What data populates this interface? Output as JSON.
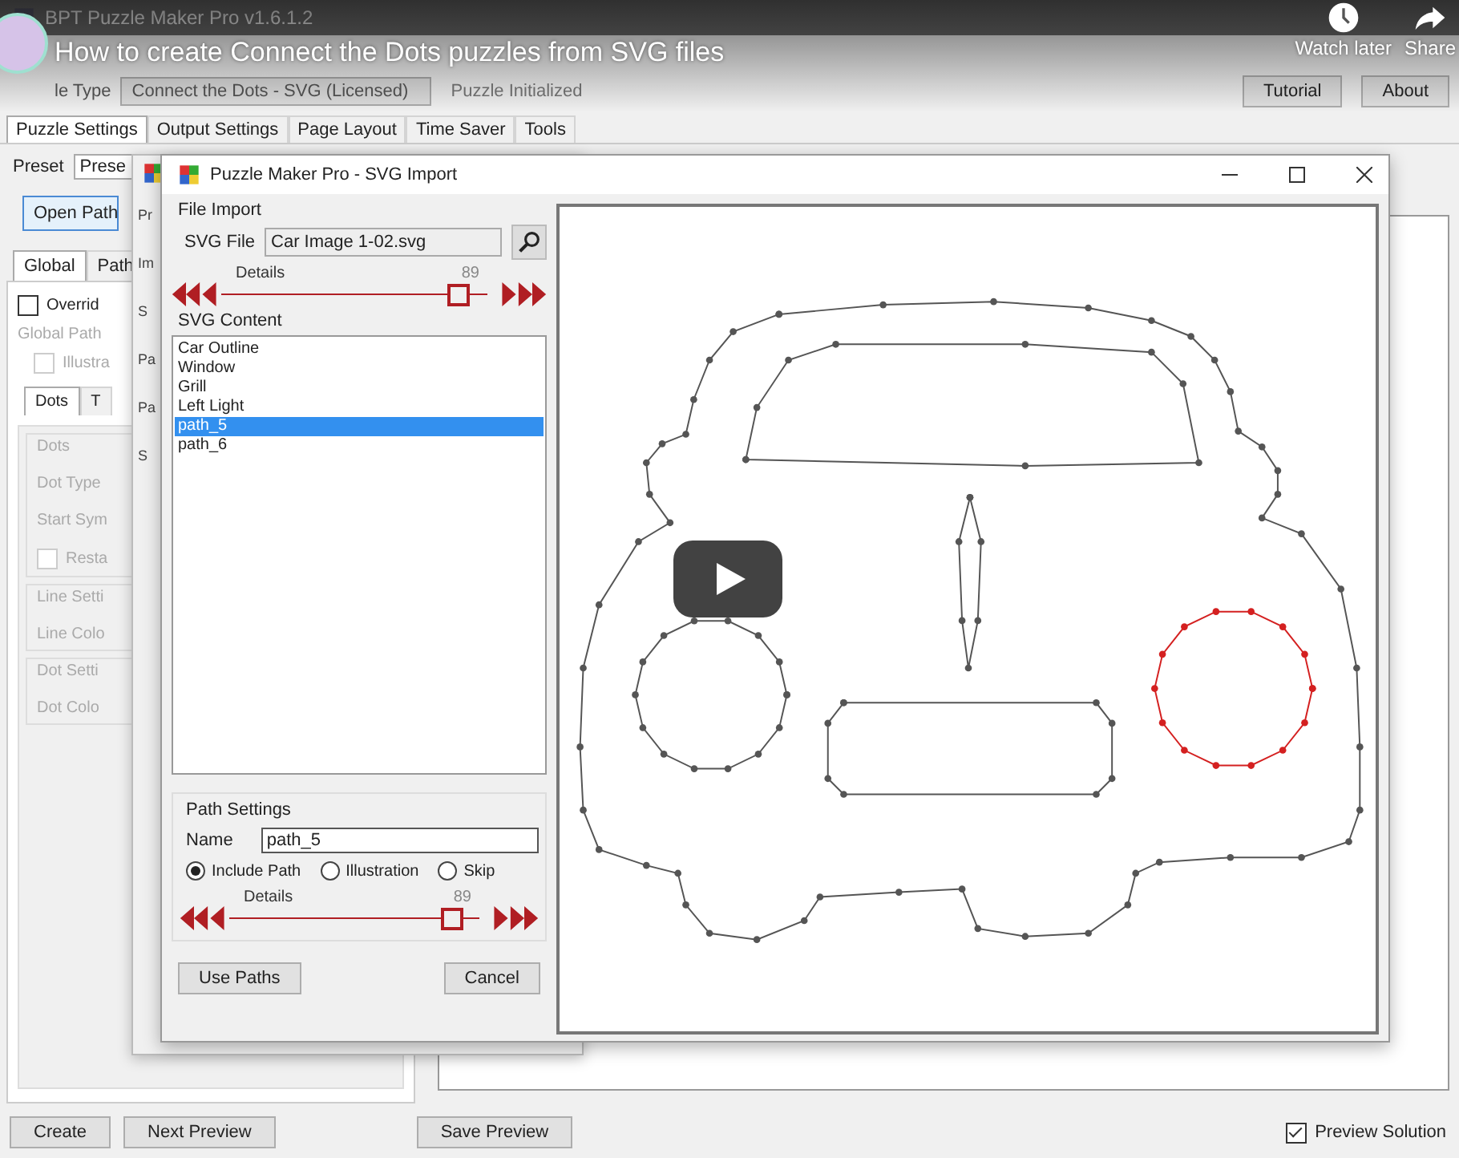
{
  "video": {
    "title": "How to create Connect the Dots puzzles from SVG files",
    "actions": [
      {
        "label": "Watch later",
        "kind": "clock"
      },
      {
        "label": "Share",
        "kind": "share"
      }
    ]
  },
  "app": {
    "title": "BPT Puzzle Maker Pro v1.6.1.2",
    "type_label": "le Type",
    "type_value": "Connect the Dots - SVG (Licensed)",
    "status": "Puzzle Initialized",
    "top_buttons": [
      "Tutorial",
      "About"
    ],
    "tabs": [
      {
        "label": "Puzzle Settings",
        "selected": true
      },
      {
        "label": "Output Settings",
        "selected": false
      },
      {
        "label": "Page Layout",
        "selected": false
      },
      {
        "label": "Time Saver",
        "selected": false
      },
      {
        "label": "Tools",
        "selected": false
      }
    ],
    "preset_label": "Preset",
    "preset_value": "Prese",
    "open_button": "Open Path",
    "sub_tabs": [
      {
        "label": "Global",
        "selected": true
      },
      {
        "label": "Path",
        "selected": false
      }
    ],
    "override": {
      "label": "Overrid",
      "checked": false
    },
    "global_path": "Global Path",
    "illustration": {
      "label": "Illustra",
      "checked": false
    },
    "inner_tabs": [
      {
        "label": "Dots",
        "selected": true
      },
      {
        "label": "T",
        "selected": false
      }
    ],
    "groups": [
      {
        "title": "Dots",
        "rows": [
          "Dot Type",
          "Start Sym"
        ],
        "checkbox": {
          "label": "Resta",
          "checked": false
        }
      },
      {
        "title": "Line Setti",
        "rows": [
          "Line Colo"
        ]
      },
      {
        "title": "Dot Setti",
        "rows": [
          "Dot Colo"
        ]
      }
    ],
    "bottom_buttons": [
      "Create",
      "Next Preview",
      "Save Preview"
    ],
    "preview_solution": {
      "label": "Preview Solution",
      "checked": true
    }
  },
  "back_dialog": {
    "fragments": [
      "Pr",
      "Im",
      "S",
      "Pa",
      "Pa",
      "S"
    ]
  },
  "import": {
    "title": "Puzzle Maker Pro - SVG Import",
    "file_group": "File Import",
    "file_label": "SVG File",
    "file_value": "Car Image 1-02.svg",
    "details": {
      "label": "Details",
      "reading": "89",
      "level": 0.89
    },
    "content_title": "SVG Content",
    "paths": [
      {
        "name": "Car Outline",
        "selected": false
      },
      {
        "name": "Window",
        "selected": false
      },
      {
        "name": "Grill",
        "selected": false
      },
      {
        "name": "Left Light",
        "selected": false
      },
      {
        "name": "path_5",
        "selected": true
      },
      {
        "name": "path_6",
        "selected": false
      }
    ],
    "path_settings": {
      "title": "Path Settings",
      "name_label": "Name",
      "name_value": "path_5",
      "options": [
        {
          "label": "Include Path",
          "selected": true
        },
        {
          "label": "Illustration",
          "selected": false
        },
        {
          "label": "Skip",
          "selected": false
        }
      ],
      "details": {
        "label": "Details",
        "reading": "89",
        "level": 0.89
      }
    },
    "buttons": [
      "Use Paths",
      "Cancel"
    ]
  }
}
